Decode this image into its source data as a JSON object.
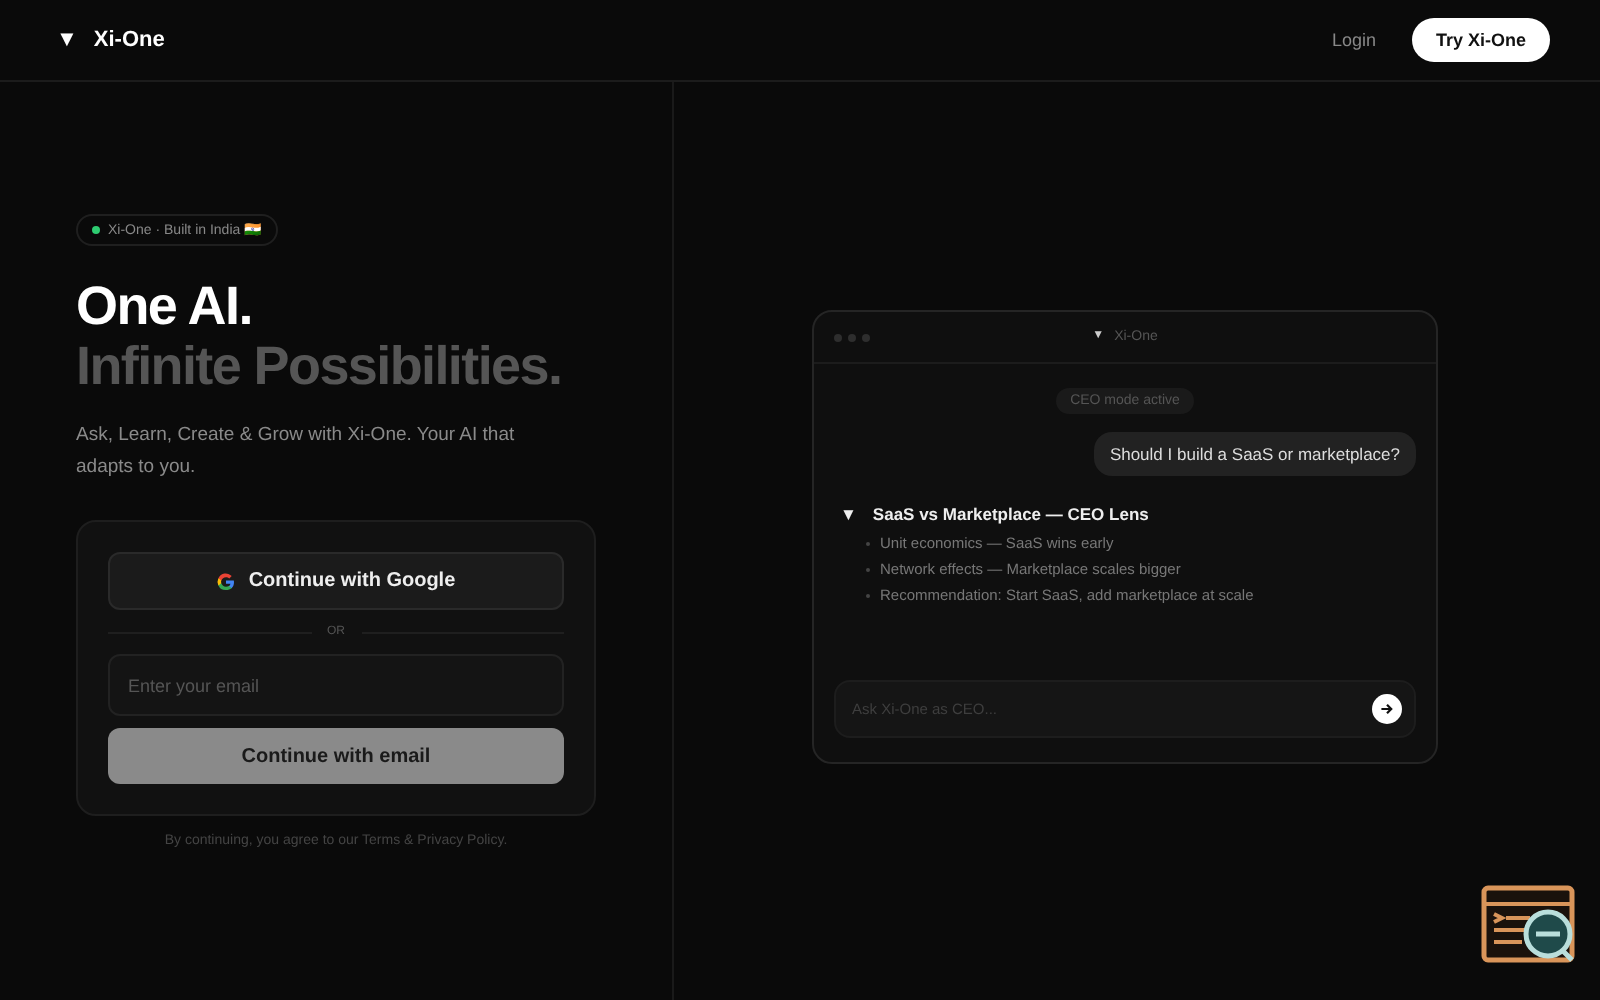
{
  "nav": {
    "logo_mark": "▼",
    "brand": "Xi-One",
    "login": "Login",
    "cta": "Try Xi-One"
  },
  "hero": {
    "badge": "Xi-One · Built in India 🇮🇳",
    "title_line_1": "One AI.",
    "title_line_2": "Infinite Possibilities.",
    "subtitle": "Ask, Learn, Create & Grow with Xi-One. Your AI that adapts to you."
  },
  "signin": {
    "google_button": "Continue with Google",
    "divider": "OR",
    "email": {
      "placeholder": "Enter your email"
    },
    "email_button": "Continue with email",
    "legal": "By continuing, you agree to our Terms & Privacy Policy."
  },
  "chat_window": {
    "title_mark": "▼",
    "title": "Xi-One",
    "mode_badge": "CEO mode active",
    "user_message": "Should I build a SaaS or marketplace?",
    "answer_mark": "▼",
    "answer_title": "SaaS vs Marketplace — CEO Lens",
    "points": [
      "Unit economics — SaaS wins early",
      "Network effects — Marketplace scales bigger",
      "Recommendation: Start SaaS, add marketplace at scale"
    ],
    "input": {
      "placeholder": "Ask Xi-One as CEO..."
    }
  }
}
